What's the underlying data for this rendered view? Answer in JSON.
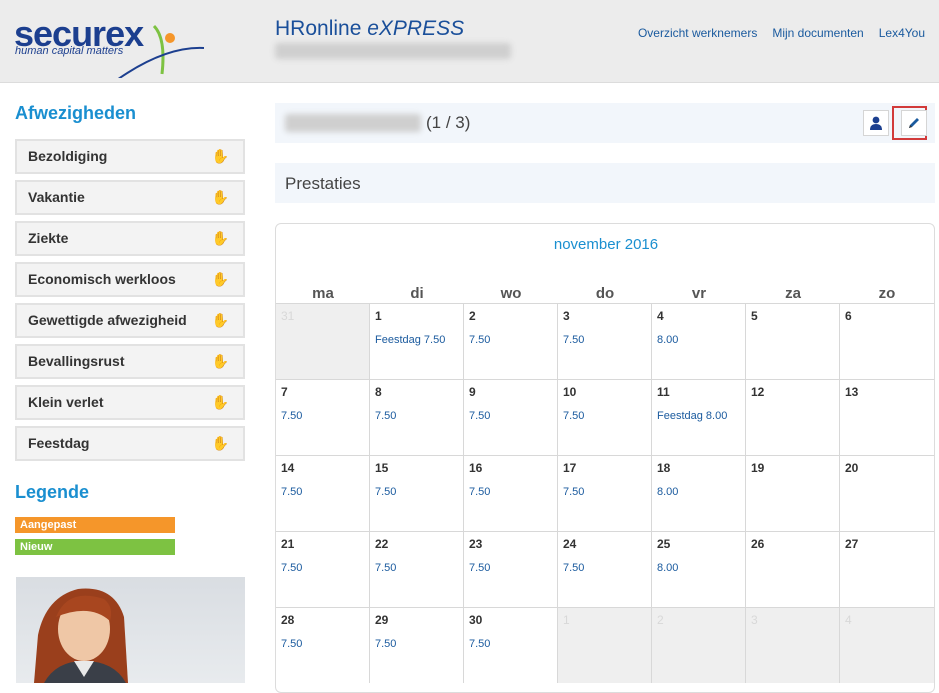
{
  "header": {
    "logo_word": "securex",
    "logo_tagline": "human capital matters",
    "app_title": "HRonline",
    "app_title_suffix": "eXPRESS",
    "nav": [
      "Overzicht werknemers",
      "Mijn documenten",
      "Lex4You"
    ]
  },
  "sidebar": {
    "absences_title": "Afwezigheden",
    "items": [
      "Bezoldiging",
      "Vakantie",
      "Ziekte",
      "Economisch werkloos",
      "Gewettigde afwezigheid",
      "Bevallingsrust",
      "Klein verlet",
      "Feestdag"
    ],
    "legend_title": "Legende",
    "legend": [
      {
        "label": "Aangepast",
        "color": "#f5962a"
      },
      {
        "label": "Nieuw",
        "color": "#7dc242"
      }
    ]
  },
  "employee": {
    "count": "(1 / 3)"
  },
  "section_title": "Prestaties",
  "calendar": {
    "month": "november 2016",
    "weekdays": [
      "ma",
      "di",
      "wo",
      "do",
      "vr",
      "za",
      "zo"
    ],
    "weeks": [
      [
        {
          "day": "31",
          "out": true,
          "hrs": ""
        },
        {
          "day": "1",
          "hrs": "Feestdag 7.50"
        },
        {
          "day": "2",
          "hrs": "7.50"
        },
        {
          "day": "3",
          "hrs": "7.50"
        },
        {
          "day": "4",
          "hrs": "8.00"
        },
        {
          "day": "5",
          "hrs": ""
        },
        {
          "day": "6",
          "hrs": ""
        }
      ],
      [
        {
          "day": "7",
          "hrs": "7.50"
        },
        {
          "day": "8",
          "hrs": "7.50"
        },
        {
          "day": "9",
          "hrs": "7.50"
        },
        {
          "day": "10",
          "hrs": "7.50"
        },
        {
          "day": "11",
          "hrs": "Feestdag 8.00"
        },
        {
          "day": "12",
          "hrs": ""
        },
        {
          "day": "13",
          "hrs": ""
        }
      ],
      [
        {
          "day": "14",
          "hrs": "7.50"
        },
        {
          "day": "15",
          "hrs": "7.50"
        },
        {
          "day": "16",
          "hrs": "7.50"
        },
        {
          "day": "17",
          "hrs": "7.50"
        },
        {
          "day": "18",
          "hrs": "8.00"
        },
        {
          "day": "19",
          "hrs": ""
        },
        {
          "day": "20",
          "hrs": ""
        }
      ],
      [
        {
          "day": "21",
          "hrs": "7.50"
        },
        {
          "day": "22",
          "hrs": "7.50"
        },
        {
          "day": "23",
          "hrs": "7.50"
        },
        {
          "day": "24",
          "hrs": "7.50"
        },
        {
          "day": "25",
          "hrs": "8.00"
        },
        {
          "day": "26",
          "hrs": ""
        },
        {
          "day": "27",
          "hrs": ""
        }
      ],
      [
        {
          "day": "28",
          "hrs": "7.50"
        },
        {
          "day": "29",
          "hrs": "7.50"
        },
        {
          "day": "30",
          "hrs": "7.50"
        },
        {
          "day": "1",
          "out": true,
          "hrs": ""
        },
        {
          "day": "2",
          "out": true,
          "hrs": ""
        },
        {
          "day": "3",
          "out": true,
          "hrs": ""
        },
        {
          "day": "4",
          "out": true,
          "hrs": ""
        }
      ]
    ]
  },
  "icons": {
    "menu_item": "hand-icon",
    "employee": "user-icon",
    "edit": "pencil-icon"
  },
  "colors": {
    "brand_blue": "#1c3f8f",
    "accent": "#1a8fd0",
    "highlight": "#d23a3a"
  }
}
